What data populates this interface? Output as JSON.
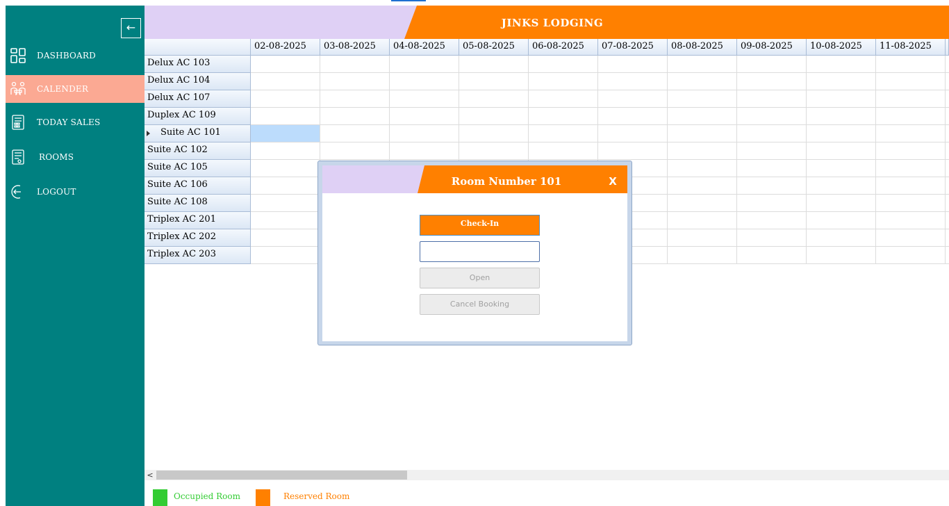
{
  "app": {
    "title": "JINKS LODGING"
  },
  "sidebar": {
    "collapse_icon": "←",
    "items": [
      {
        "label": "DASHBOARD",
        "icon": "dashboard-icon",
        "active": false
      },
      {
        "label": "CALENDER",
        "icon": "calendar-icon",
        "active": true
      },
      {
        "label": "TODAY SALES",
        "icon": "sales-icon",
        "active": false
      },
      {
        "label": "ROOMS",
        "icon": "rooms-icon",
        "active": false
      },
      {
        "label": "LOGOUT",
        "icon": "logout-icon",
        "active": false
      }
    ]
  },
  "grid": {
    "dates": [
      "02-08-2025",
      "03-08-2025",
      "04-08-2025",
      "05-08-2025",
      "06-08-2025",
      "07-08-2025",
      "08-08-2025",
      "09-08-2025",
      "10-08-2025",
      "11-08-2025"
    ],
    "rooms": [
      "Delux AC 103",
      "Delux AC 104",
      "Delux AC 107",
      "Duplex AC 109",
      "Suite AC 101",
      "Suite AC 102",
      "Suite AC 105",
      "Suite AC 106",
      "Suite AC 108",
      "Triplex AC 201",
      "Triplex AC 202",
      "Triplex AC 203"
    ],
    "current_row": "Suite AC 101"
  },
  "dialog": {
    "title": "Room Number 101",
    "close_label": "X",
    "checkin_label": "Check-In",
    "input_value": "",
    "open_label": "Open",
    "cancel_label": "Cancel Booking"
  },
  "legend": {
    "occupied": {
      "label": "Occupied Room",
      "color": "#33cc33"
    },
    "reserved": {
      "label": "Reserved Room",
      "color": "#ff8000"
    }
  },
  "colors": {
    "sidebar": "#008080",
    "accent": "#ff8000",
    "active_nav": "#fba993",
    "header_lavender": "#dfd0f5"
  }
}
